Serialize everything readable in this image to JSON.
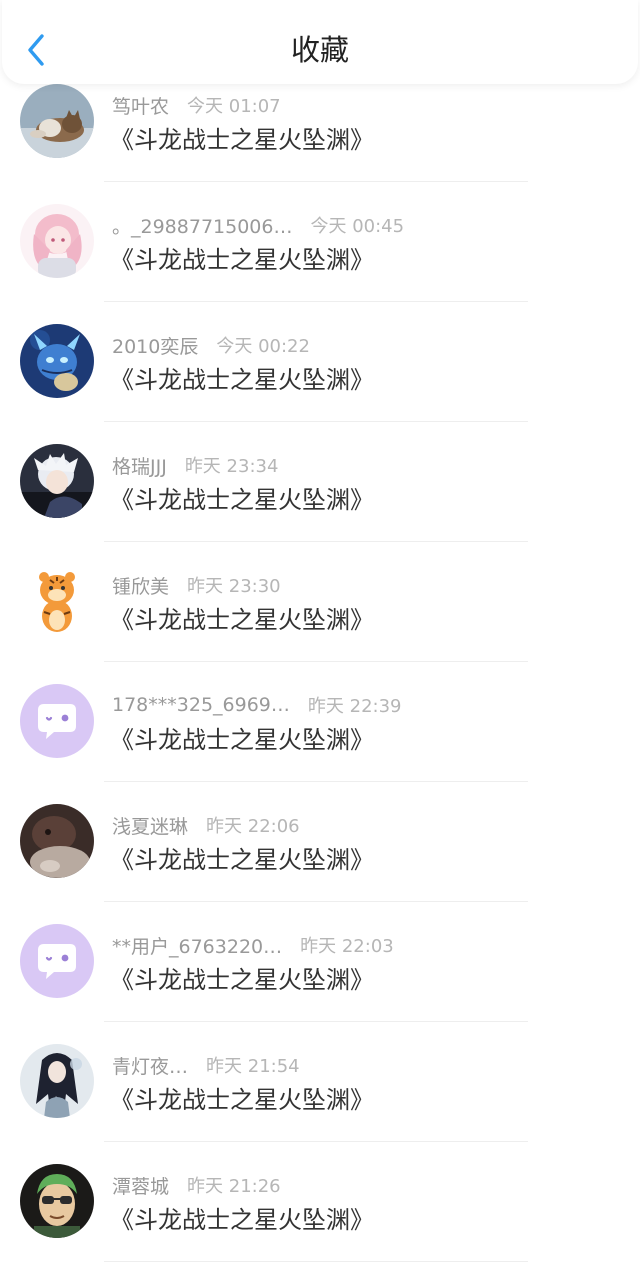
{
  "header": {
    "title": "收藏",
    "back_icon": "chevron-left-icon",
    "accent_color": "#2f9bf0"
  },
  "favorites": [
    {
      "user": "笃叶农",
      "time": "今天 01:07",
      "work": "《斗龙战士之星火坠渊》",
      "avatar": "cat-photo"
    },
    {
      "user": "。_29887715006…",
      "time": "今天 00:45",
      "work": "《斗龙战士之星火坠渊》",
      "avatar": "anime-girl-pink"
    },
    {
      "user": "2010奕辰",
      "time": "今天 00:22",
      "work": "《斗龙战士之星火坠渊》",
      "avatar": "blue-dragon"
    },
    {
      "user": "格瑞JJJ",
      "time": "昨天 23:34",
      "work": "《斗龙战士之星火坠渊》",
      "avatar": "anime-boy-white-hair"
    },
    {
      "user": "锺欣美",
      "time": "昨天 23:30",
      "work": "《斗龙战士之星火坠渊》",
      "avatar": "cartoon-tiger"
    },
    {
      "user": "178***325_6969…",
      "time": "昨天 22:39",
      "work": "《斗龙战士之星火坠渊》",
      "avatar": "default-chat-bubble"
    },
    {
      "user": "浅夏迷琳",
      "time": "昨天 22:06",
      "work": "《斗龙战士之星火坠渊》",
      "avatar": "dark-photo"
    },
    {
      "user": "**用户_6763220…",
      "time": "昨天 22:03",
      "work": "《斗龙战士之星火坠渊》",
      "avatar": "default-chat-bubble"
    },
    {
      "user": "青灯夜…",
      "time": "昨天 21:54",
      "work": "《斗龙战士之星火坠渊》",
      "avatar": "anime-dark-hair"
    },
    {
      "user": "潭蓉城",
      "time": "昨天 21:26",
      "work": "《斗龙战士之星火坠渊》",
      "avatar": "green-hair-character"
    }
  ]
}
